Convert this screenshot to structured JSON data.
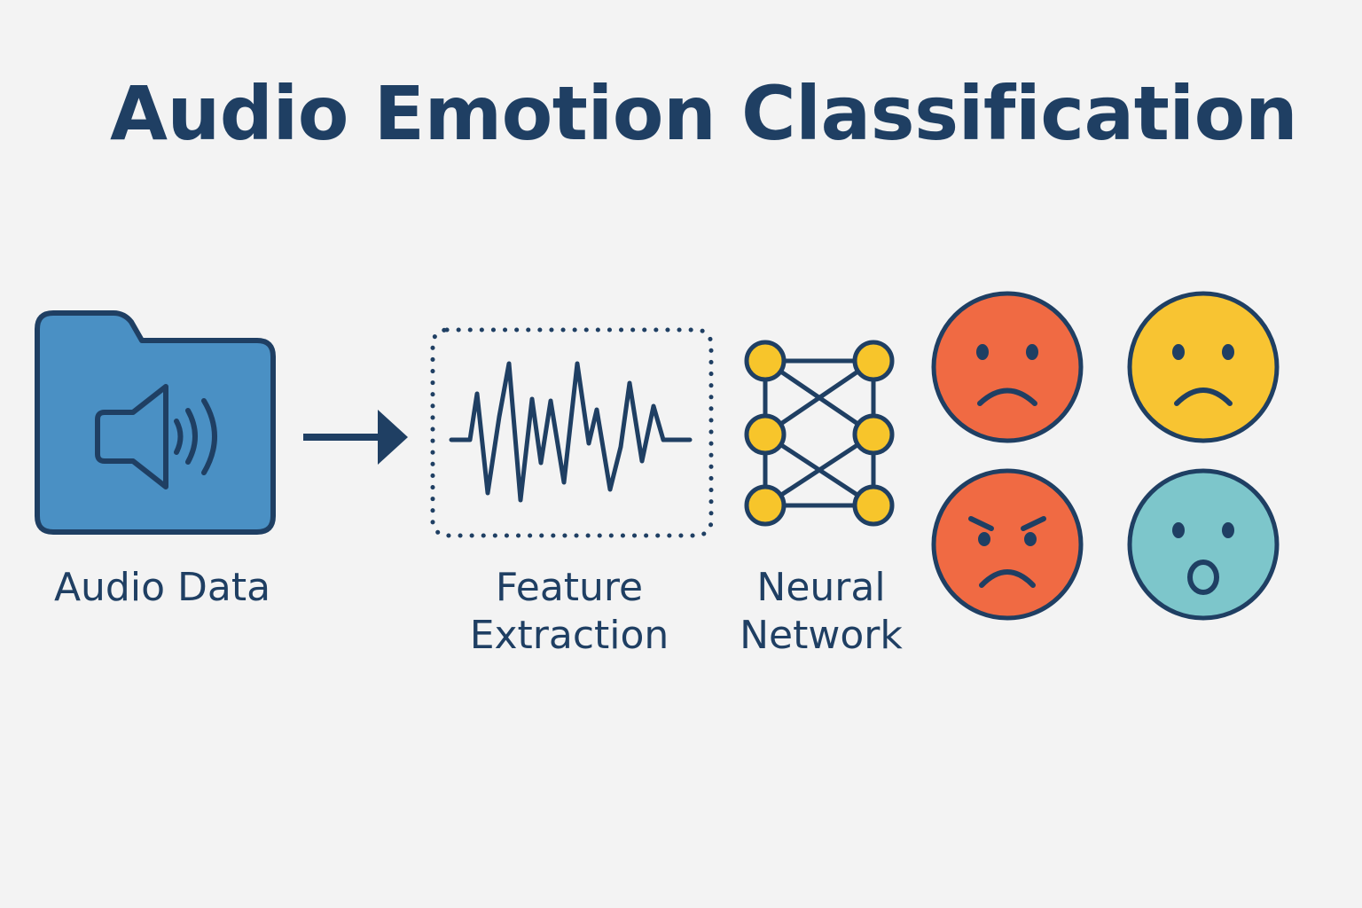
{
  "title": "Audio Emotion Classification",
  "steps": {
    "audio_data": "Audio Data",
    "feature_extraction": [
      "Feature",
      "Extraction"
    ],
    "neural_network": [
      "Neural",
      "Network"
    ]
  },
  "icons": {
    "folder": "folder-speaker-icon",
    "arrow": "arrow-right-icon",
    "waveform": "waveform-icon",
    "network": "neural-network-icon",
    "emotions": [
      "sad-face-icon",
      "worried-face-icon",
      "angry-face-icon",
      "surprised-face-icon"
    ]
  },
  "colors": {
    "ink": "#1f3f63",
    "background": "#f3f3f3",
    "folder": "#4a90c4",
    "node": "#f7c52b",
    "face_red": "#f06a43",
    "face_yellow": "#f8c432",
    "face_teal": "#7dc6cb"
  }
}
